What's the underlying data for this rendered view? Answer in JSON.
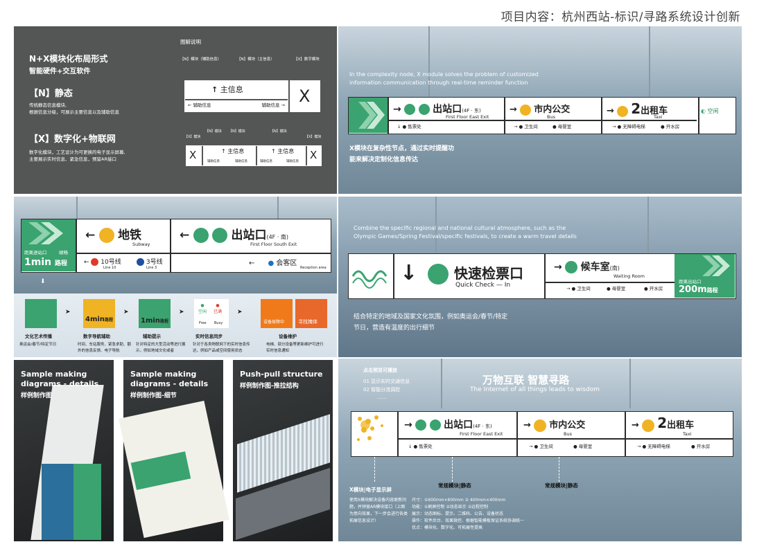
{
  "page_title": "项目内容：杭州西站-标识/寻路系统设计创新",
  "panel1": {
    "heading": "N+X模块化布局形式",
    "subheading": "智能硬件+交互软件",
    "n_title": "【N】静态",
    "n_desc1": "传统静态信息模块,",
    "n_desc2": "根据信息分级，可展示主要信息以及辅助信息",
    "x_title": "【X】数字化+物联网",
    "x_desc1": "数字化模块，工艺设计为可更换的电子显示屏幕,",
    "x_desc2": "主要展示实时信息、紧急信息，预留AR接口",
    "legend_title": "图解说明",
    "lbl_n_aux": "【N】模块（辅助信息）",
    "lbl_n_main": "【N】模块（主信息）",
    "lbl_x_digital": "【X】数字模块",
    "main_info": "主信息",
    "aux_info_left": "辅助信息",
    "aux_info_right": "辅助信息",
    "x_letter": "X",
    "lbl_small_n": "【N】模块",
    "lbl_small_x": "【X】模块"
  },
  "panel2": {
    "caption_en1": "In the complexity node, X module solves the problem of customized",
    "caption_en2": "information communication through real-time reminder function",
    "caption_cn1": "X模块在复杂性节点，通过实时提醒功",
    "caption_cn2": "能来解决定制化信息传达",
    "exit_cn": "出站口",
    "exit_floor": "(4F · 东)",
    "exit_en": "First Floor East Exit",
    "bus_cn": "市内公交",
    "bus_en": "Bus",
    "taxi_num": "2",
    "taxi_cn": "出租车",
    "taxi_en": "Taxi",
    "ticket": "售票处",
    "toilet": "卫生间",
    "nursing": "母婴室",
    "elevator": "无障碍电梯",
    "water": "开水房",
    "vacant": "空闲"
  },
  "panel3": {
    "dist_label": "距离进站口",
    "smooth": "顺畅",
    "time": "1min",
    "route": "路程",
    "subway_cn": "地铁",
    "subway_en": "Subway",
    "exit_cn": "出站口",
    "exit_floor": "(4F · 南)",
    "exit_en": "First Floor South Exit",
    "line10": "10号线",
    "line10_en": "Line 10",
    "line3": "3号线",
    "line3_en": "Line 3",
    "reception": "会客区",
    "reception_en": "Reception area"
  },
  "panel4": {
    "items": [
      {
        "title": "文化艺术传播",
        "desc": "奥运会/春节/特定节日"
      },
      {
        "title": "数字导航辅助",
        "desc": "时间、车站服务、紧急求助、额外的信息反馈、电子导航"
      },
      {
        "title": "辅助提示",
        "desc": "针对特定的大型活动等进行展示，例如地域文化或者"
      },
      {
        "title": "实时信息同步",
        "desc": "针对于各类物联网下的实时信息传达，例如产品或空间使用状态"
      },
      {
        "title": "设备维护",
        "desc": "电梯、部分设备等更新维护可进行实时信息通知"
      }
    ],
    "mini_time": "4min",
    "mini_route": "路程",
    "mini_time2": "1min",
    "mini_route2": "路程",
    "vacant": "空闲",
    "full": "已满",
    "vacant_en": "Free",
    "full_en": "Busy",
    "device_fault": "设备故障中",
    "shelter": "寻找掩体"
  },
  "panel5": {
    "caption_en1": "Combine the specific regional and national cultural atmosphere, such as the",
    "caption_en2": "Olympic Games/Spring Festival/specific festivals, to create a warm travel details",
    "caption_cn1": "结合特定的地域及国家文化氛围，例如奥运会/春节/特定",
    "caption_cn2": "节日，营造有温度的出行细节",
    "check_cn": "快速检票口",
    "check_en": "Quick Check — In",
    "waiting_cn": "候车室",
    "waiting_dir": "(南)",
    "waiting_en": "Waiting Room",
    "toilet": "卫生间",
    "nursing": "母婴室",
    "water": "开水房",
    "dist_label": "距离出站口",
    "dist": "200m",
    "route": "路程"
  },
  "panel6": {
    "title_en1": "Sample making",
    "title_en2": "diagrams - details",
    "title_cn": "样例制作图"
  },
  "panel7": {
    "title_en1": "Sample making",
    "title_en2": "diagrams - details",
    "title_cn": "样例制作图-细节"
  },
  "panel8": {
    "title_en1": "Push-pull structure",
    "title_cn": "样例制作图-推拉结构"
  },
  "panel9": {
    "click_label": "点击预览可播放",
    "item1": "01 显示实时交通信息",
    "item2": "02 智能分流调控",
    "dots": "……",
    "title_cn": "万物互联 智慧寻路",
    "title_en": "The Internet of all things leads to wisdom",
    "exit_cn": "出站口",
    "exit_floor": "(4F · 东)",
    "exit_en": "First Floor East Exit",
    "bus_cn": "市内公交",
    "bus_en": "Bus",
    "taxi_num": "2",
    "taxi_cn": "出租车",
    "taxi_en": "Taxi",
    "ticket": "售票处",
    "toilet": "卫生间",
    "nursing": "母婴室",
    "elevator": "无障碍电梯",
    "water": "开水房",
    "x_label": "X模块|电子显示屏",
    "n_label1": "常规模块|静态",
    "n_label2": "常规模块|静态",
    "x_desc1": "使用X模块解决设备内容更新问",
    "x_desc2": "题，并预留AR模块接口（上图",
    "x_desc3": "为意向效果，下一步会进行各类",
    "x_desc4": "拓展信息设计）",
    "spec1": "尺寸：①600mm×600mm ② 400mm×400mm",
    "spec2": "功能：①刷屏控制 ②动态显示 ③远程控制",
    "spec3": "展示：动态图标、提示、二维码、公告、设备状态",
    "spec4": "操作：软件后台、效果微控、根据智能模板保证系统协调统一",
    "spec5": "优点：模块化、数字化、可拓展性提高"
  },
  "colors": {
    "green": "#3aa36f",
    "yellow": "#f0b323",
    "red": "#e0392a",
    "blue": "#1e4fa0",
    "orange": "#f07a1a"
  }
}
